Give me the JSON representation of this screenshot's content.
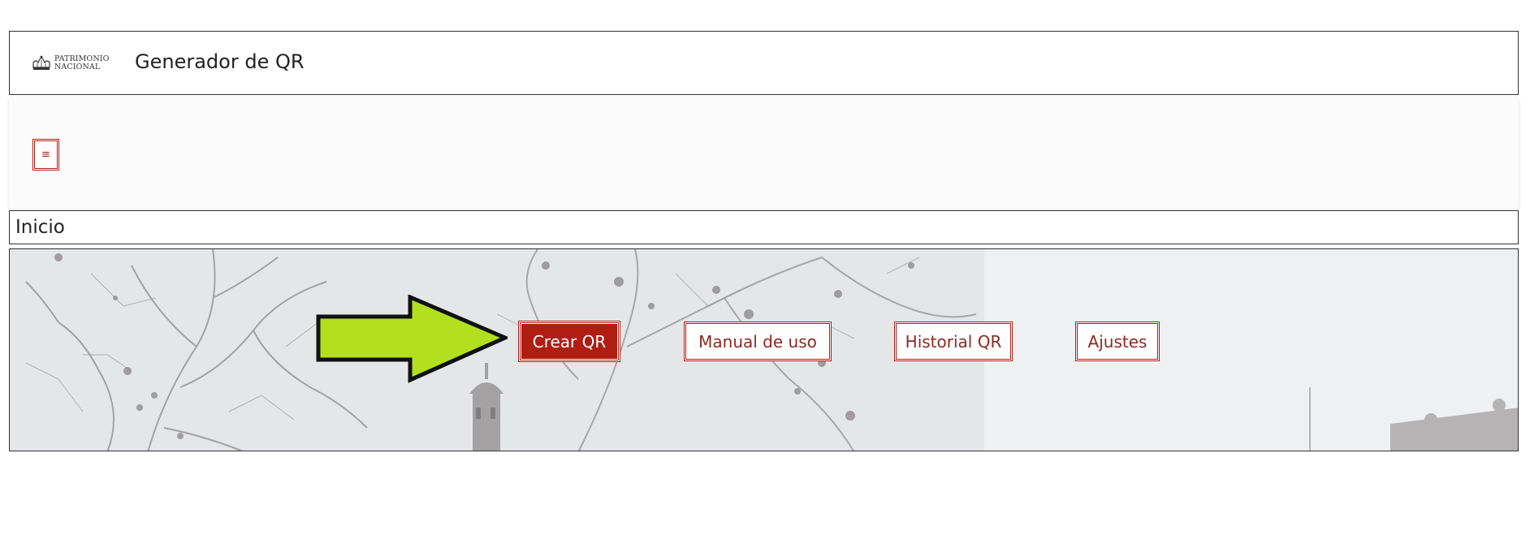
{
  "header": {
    "logo_line1": "PATRIMONIO",
    "logo_line2": "NACIONAL",
    "title": "Generador de QR"
  },
  "navbar": {
    "menu_icon": "hamburger-icon",
    "menu_glyph": "≡"
  },
  "breadcrumb": {
    "current": "Inicio"
  },
  "hero": {
    "buttons": [
      {
        "label": "Crear QR",
        "active": true
      },
      {
        "label": "Manual de uso",
        "active": false
      },
      {
        "label": "Historial QR",
        "active": false
      },
      {
        "label": "Ajustes",
        "active": false
      }
    ],
    "pointer_icon": "green-arrow-icon"
  },
  "colors": {
    "accent": "#b01d13",
    "arrow_fill": "#b2e01f",
    "border": "#333333"
  }
}
